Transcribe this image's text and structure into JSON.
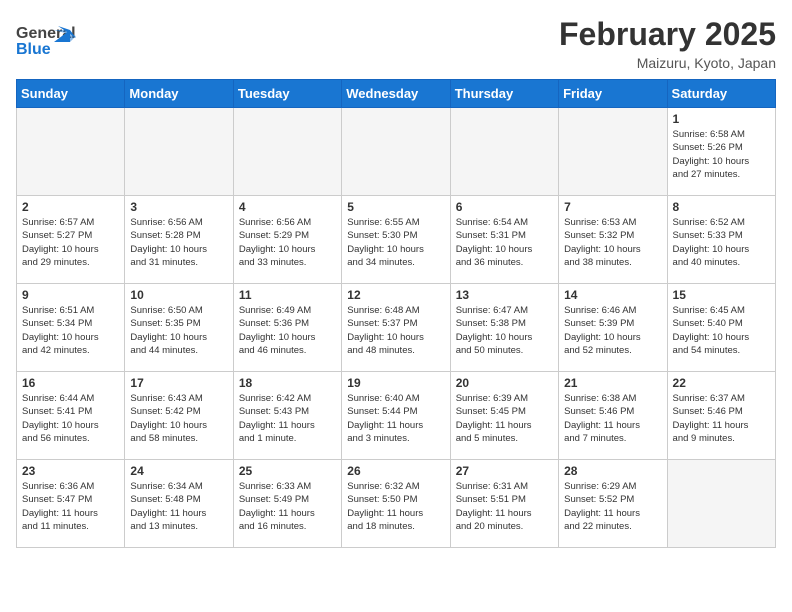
{
  "header": {
    "logo_general": "General",
    "logo_blue": "Blue",
    "title": "February 2025",
    "subtitle": "Maizuru, Kyoto, Japan"
  },
  "weekdays": [
    "Sunday",
    "Monday",
    "Tuesday",
    "Wednesday",
    "Thursday",
    "Friday",
    "Saturday"
  ],
  "weeks": [
    [
      {
        "day": "",
        "info": ""
      },
      {
        "day": "",
        "info": ""
      },
      {
        "day": "",
        "info": ""
      },
      {
        "day": "",
        "info": ""
      },
      {
        "day": "",
        "info": ""
      },
      {
        "day": "",
        "info": ""
      },
      {
        "day": "1",
        "info": "Sunrise: 6:58 AM\nSunset: 5:26 PM\nDaylight: 10 hours\nand 27 minutes."
      }
    ],
    [
      {
        "day": "2",
        "info": "Sunrise: 6:57 AM\nSunset: 5:27 PM\nDaylight: 10 hours\nand 29 minutes."
      },
      {
        "day": "3",
        "info": "Sunrise: 6:56 AM\nSunset: 5:28 PM\nDaylight: 10 hours\nand 31 minutes."
      },
      {
        "day": "4",
        "info": "Sunrise: 6:56 AM\nSunset: 5:29 PM\nDaylight: 10 hours\nand 33 minutes."
      },
      {
        "day": "5",
        "info": "Sunrise: 6:55 AM\nSunset: 5:30 PM\nDaylight: 10 hours\nand 34 minutes."
      },
      {
        "day": "6",
        "info": "Sunrise: 6:54 AM\nSunset: 5:31 PM\nDaylight: 10 hours\nand 36 minutes."
      },
      {
        "day": "7",
        "info": "Sunrise: 6:53 AM\nSunset: 5:32 PM\nDaylight: 10 hours\nand 38 minutes."
      },
      {
        "day": "8",
        "info": "Sunrise: 6:52 AM\nSunset: 5:33 PM\nDaylight: 10 hours\nand 40 minutes."
      }
    ],
    [
      {
        "day": "9",
        "info": "Sunrise: 6:51 AM\nSunset: 5:34 PM\nDaylight: 10 hours\nand 42 minutes."
      },
      {
        "day": "10",
        "info": "Sunrise: 6:50 AM\nSunset: 5:35 PM\nDaylight: 10 hours\nand 44 minutes."
      },
      {
        "day": "11",
        "info": "Sunrise: 6:49 AM\nSunset: 5:36 PM\nDaylight: 10 hours\nand 46 minutes."
      },
      {
        "day": "12",
        "info": "Sunrise: 6:48 AM\nSunset: 5:37 PM\nDaylight: 10 hours\nand 48 minutes."
      },
      {
        "day": "13",
        "info": "Sunrise: 6:47 AM\nSunset: 5:38 PM\nDaylight: 10 hours\nand 50 minutes."
      },
      {
        "day": "14",
        "info": "Sunrise: 6:46 AM\nSunset: 5:39 PM\nDaylight: 10 hours\nand 52 minutes."
      },
      {
        "day": "15",
        "info": "Sunrise: 6:45 AM\nSunset: 5:40 PM\nDaylight: 10 hours\nand 54 minutes."
      }
    ],
    [
      {
        "day": "16",
        "info": "Sunrise: 6:44 AM\nSunset: 5:41 PM\nDaylight: 10 hours\nand 56 minutes."
      },
      {
        "day": "17",
        "info": "Sunrise: 6:43 AM\nSunset: 5:42 PM\nDaylight: 10 hours\nand 58 minutes."
      },
      {
        "day": "18",
        "info": "Sunrise: 6:42 AM\nSunset: 5:43 PM\nDaylight: 11 hours\nand 1 minute."
      },
      {
        "day": "19",
        "info": "Sunrise: 6:40 AM\nSunset: 5:44 PM\nDaylight: 11 hours\nand 3 minutes."
      },
      {
        "day": "20",
        "info": "Sunrise: 6:39 AM\nSunset: 5:45 PM\nDaylight: 11 hours\nand 5 minutes."
      },
      {
        "day": "21",
        "info": "Sunrise: 6:38 AM\nSunset: 5:46 PM\nDaylight: 11 hours\nand 7 minutes."
      },
      {
        "day": "22",
        "info": "Sunrise: 6:37 AM\nSunset: 5:46 PM\nDaylight: 11 hours\nand 9 minutes."
      }
    ],
    [
      {
        "day": "23",
        "info": "Sunrise: 6:36 AM\nSunset: 5:47 PM\nDaylight: 11 hours\nand 11 minutes."
      },
      {
        "day": "24",
        "info": "Sunrise: 6:34 AM\nSunset: 5:48 PM\nDaylight: 11 hours\nand 13 minutes."
      },
      {
        "day": "25",
        "info": "Sunrise: 6:33 AM\nSunset: 5:49 PM\nDaylight: 11 hours\nand 16 minutes."
      },
      {
        "day": "26",
        "info": "Sunrise: 6:32 AM\nSunset: 5:50 PM\nDaylight: 11 hours\nand 18 minutes."
      },
      {
        "day": "27",
        "info": "Sunrise: 6:31 AM\nSunset: 5:51 PM\nDaylight: 11 hours\nand 20 minutes."
      },
      {
        "day": "28",
        "info": "Sunrise: 6:29 AM\nSunset: 5:52 PM\nDaylight: 11 hours\nand 22 minutes."
      },
      {
        "day": "",
        "info": ""
      }
    ]
  ]
}
